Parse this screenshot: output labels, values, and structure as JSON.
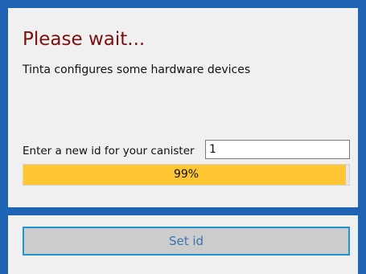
{
  "dialog": {
    "title": "Please wait...",
    "message": "Tinta configures some hardware devices",
    "id_label": "Enter a new id for your canister",
    "id_value": "1",
    "progress": {
      "value": 99,
      "label": "99%"
    }
  },
  "footer": {
    "set_id_label": "Set id"
  },
  "colors": {
    "window_background": "#1f63b4",
    "title": "#7a1010",
    "progress_fill": "#fdc632",
    "button_border": "#1f95d6",
    "button_text": "#3f73b0"
  }
}
